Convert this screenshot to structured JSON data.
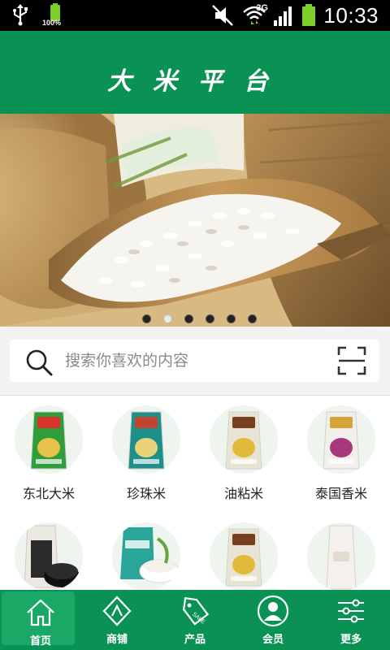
{
  "status_bar": {
    "battery_small_label": "100%",
    "network_label": "3G",
    "time": "10:33"
  },
  "header": {
    "title": "大米平台"
  },
  "banner": {
    "dot_count": 6,
    "active_dot_index": 1
  },
  "search": {
    "placeholder": "搜索你喜欢的内容"
  },
  "categories": [
    {
      "label": "东北大米",
      "icon": "rice-bag-icon"
    },
    {
      "label": "珍珠米",
      "icon": "rice-bag-icon"
    },
    {
      "label": "油粘米",
      "icon": "rice-bag-icon"
    },
    {
      "label": "泰国香米",
      "icon": "rice-bag-icon"
    },
    {
      "label": "",
      "icon": "black-rice-icon"
    },
    {
      "label": "",
      "icon": "rice-bowl-icon"
    },
    {
      "label": "",
      "icon": "rice-bag-icon"
    },
    {
      "label": "",
      "icon": "paper-bag-icon"
    }
  ],
  "bottom_nav": [
    {
      "label": "首页",
      "icon": "home-icon",
      "active": true
    },
    {
      "label": "商铺",
      "icon": "shop-icon",
      "active": false
    },
    {
      "label": "产品",
      "icon": "sale-tag-icon",
      "active": false
    },
    {
      "label": "会员",
      "icon": "member-icon",
      "active": false
    },
    {
      "label": "更多",
      "icon": "sliders-icon",
      "active": false
    }
  ],
  "colors": {
    "brand_green": "#0a9255",
    "active_tab": "#1aa866"
  }
}
